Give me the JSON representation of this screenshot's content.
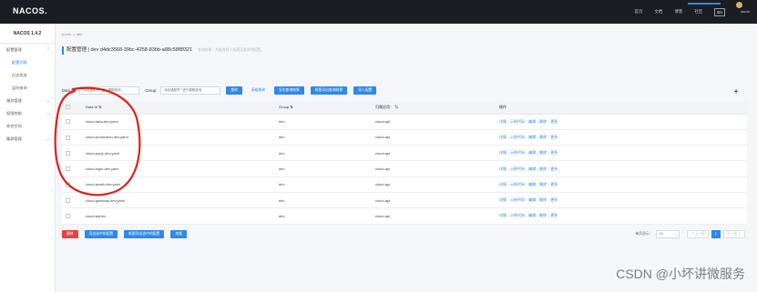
{
  "app": {
    "logo": "NACOS."
  },
  "topnav": {
    "items": [
      "首页",
      "文档",
      "博客",
      "社区"
    ],
    "lang": "En",
    "user": "nacos"
  },
  "sidebar": {
    "title": "NACOS 1.4.2",
    "items": [
      {
        "label": "配置管理",
        "sub": false,
        "active": false,
        "chev": "⌃"
      },
      {
        "label": "配置列表",
        "sub": true,
        "active": true
      },
      {
        "label": "历史版本",
        "sub": true,
        "active": false
      },
      {
        "label": "监听查询",
        "sub": true,
        "active": false
      },
      {
        "label": "服务管理",
        "sub": false,
        "active": false,
        "chev": "⌄"
      },
      {
        "label": "权限控制",
        "sub": false,
        "active": false,
        "chev": "⌄"
      },
      {
        "label": "命名空间",
        "sub": false,
        "active": false
      },
      {
        "label": "集群管理",
        "sub": false,
        "active": false,
        "chev": "⌄"
      }
    ]
  },
  "breadcrumb": {
    "ns1": "public",
    "sep": "|",
    "ns2": "dev"
  },
  "header": {
    "title": "配置管理 | dev d4dc3568-39bc-4258-83bb-a88c58f8f321",
    "hint": "查询结果：共查询到 7 条满足要求的配置。"
  },
  "filters": {
    "dataid_label": "Data ID:",
    "dataid_placeholder": "添加通配符'*'进行模糊查询",
    "group_label": "Group:",
    "group_placeholder": "添加通配符'*'进行模糊查询",
    "query_btn": "查询",
    "advanced": "高级查询",
    "export_btn": "导出查询结果",
    "export_new_btn": "新版导出查询结果",
    "import_btn": "导入配置",
    "add": "+"
  },
  "table": {
    "headers": {
      "dataid": "Data Id ⇅",
      "group": "Group ⇅",
      "app": "归属应用： ⇅",
      "ops": "操作"
    },
    "rows": [
      {
        "dataid": "cloud-data-dev.yaml",
        "group": "dev",
        "app": "cloud-api"
      },
      {
        "dataid": "cloud-production-dev.yaml",
        "group": "dev",
        "app": "cloud-api"
      },
      {
        "dataid": "cloud-party-dev.yaml",
        "group": "dev",
        "app": "cloud-api"
      },
      {
        "dataid": "cloud-login-dev.yaml",
        "group": "dev",
        "app": "cloud-api"
      },
      {
        "dataid": "cloud-auath-dev.yaml",
        "group": "dev",
        "app": "cloud-api"
      },
      {
        "dataid": "cloud-gateway-dev.yaml",
        "group": "dev",
        "app": "cloud-api"
      },
      {
        "dataid": "cloud-admin",
        "group": "dev",
        "app": "cloud-api"
      }
    ],
    "ops": [
      "详情",
      "示例代码",
      "编辑",
      "删除",
      "更多"
    ]
  },
  "bottom": {
    "delete_btn": "删除",
    "export_sel_btn": "导出选中的配置",
    "export_sel_new_btn": "新版导出选中的配置",
    "clone_btn": "克隆"
  },
  "pager": {
    "size_label": "每页显示：",
    "size": "10",
    "prev": "〈 上一页",
    "page": "1",
    "next": "下一页 〉"
  },
  "watermark": "CSDN @小坏讲微服务",
  "colors": {
    "primary": "#2f89e8",
    "danger": "#e64242",
    "topbar": "#1a1d23",
    "annotation": "#e0201a"
  }
}
